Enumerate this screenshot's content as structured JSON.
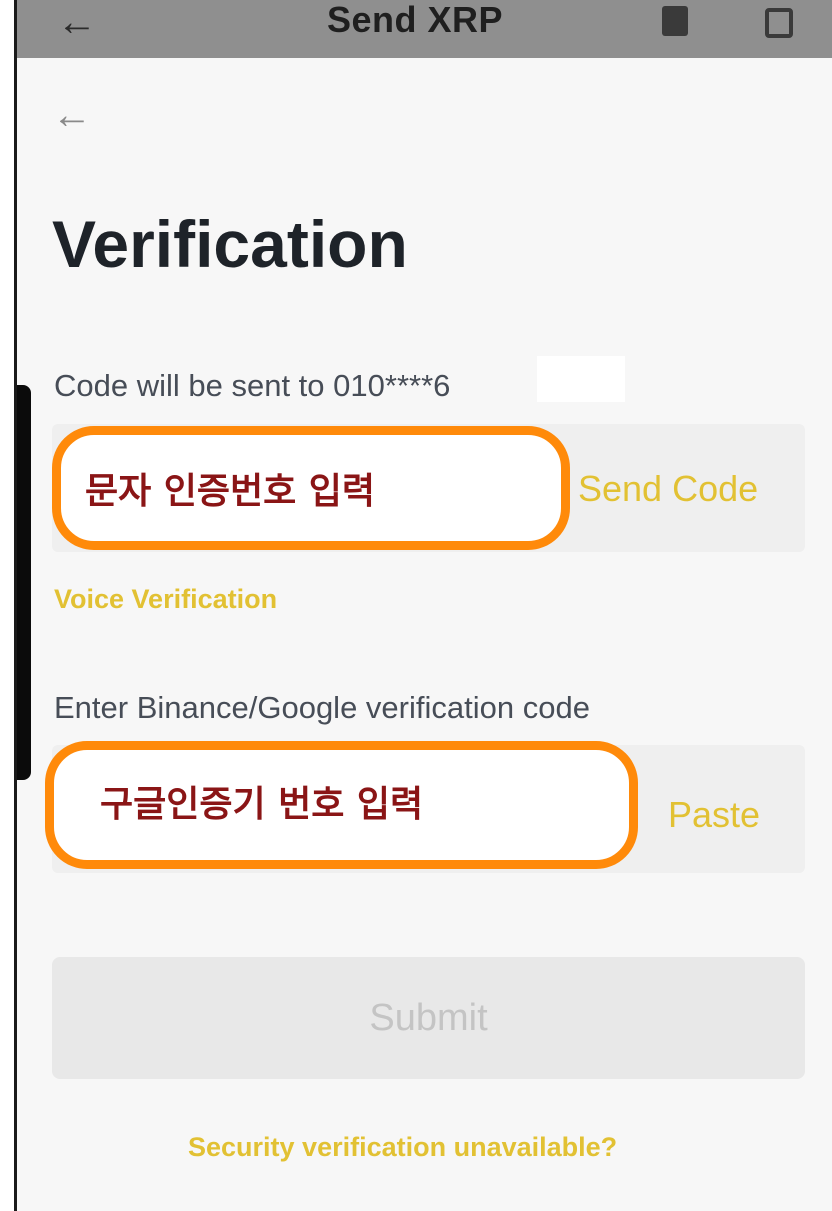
{
  "background_screen": {
    "title": "Send XRP",
    "back_icon": "arrow-left-icon",
    "icons": [
      "document-icon",
      "history-icon"
    ]
  },
  "verification": {
    "back_icon": "arrow-left-icon",
    "title": "Verification",
    "sms": {
      "label": "Code will be sent to 010****6",
      "input_annotation": "문자 인증번호 입력",
      "action": "Send Code"
    },
    "voice_link": "Voice Verification",
    "authenticator": {
      "label": "Enter Binance/Google verification code",
      "input_annotation": "구글인증기 번호 입력",
      "action": "Paste"
    },
    "submit_label": "Submit",
    "help_link": "Security verification unavailable?"
  },
  "colors": {
    "accent": "#e2c133",
    "annotation_border": "#ff8a0a",
    "annotation_text": "#8a1516",
    "title": "#1e2329"
  }
}
